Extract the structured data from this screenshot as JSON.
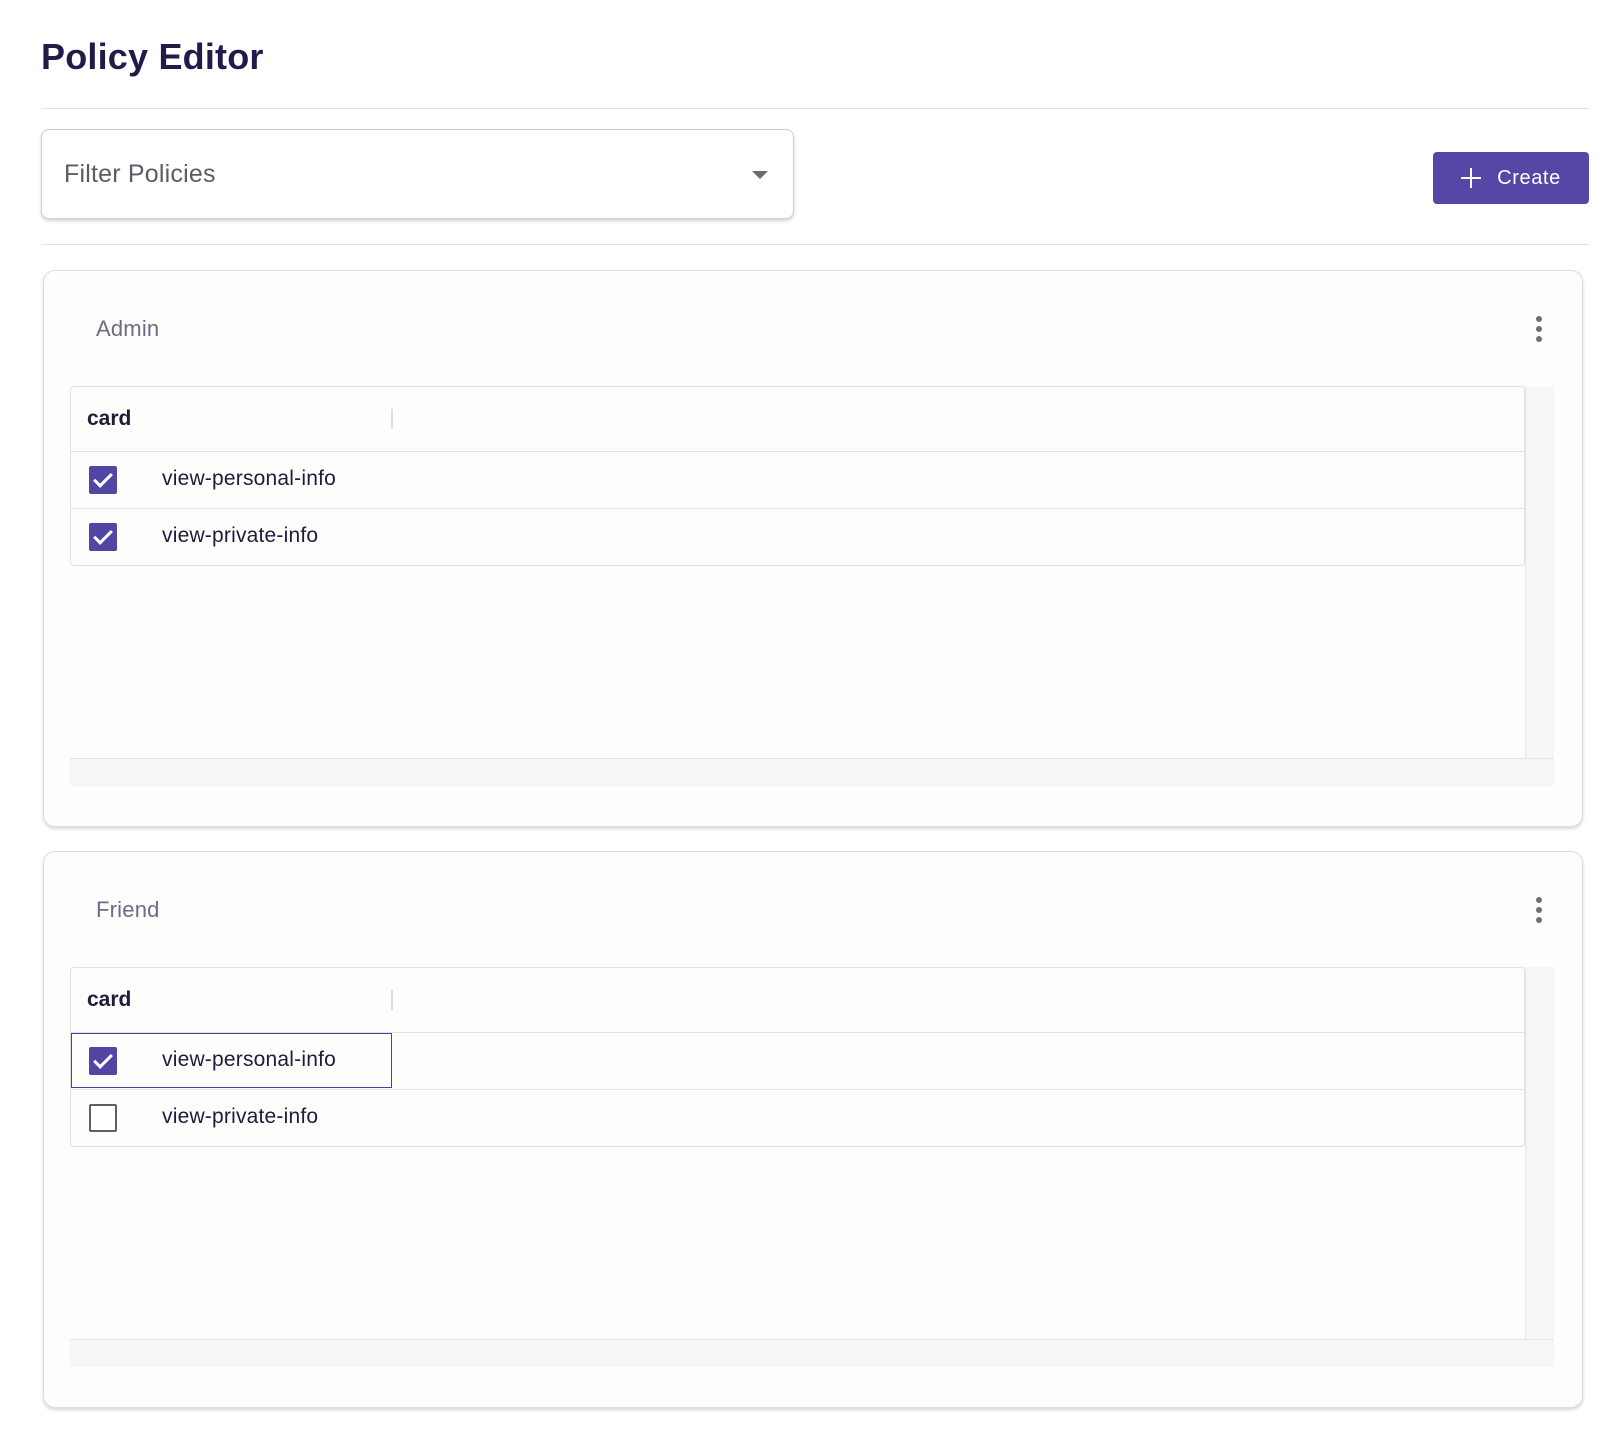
{
  "page": {
    "title": "Policy Editor"
  },
  "toolbar": {
    "filter_placeholder": "Filter Policies",
    "create_label": "Create"
  },
  "colors": {
    "accent": "#5447a6",
    "title": "#201c4a",
    "policy_name": "#6d6b85"
  },
  "policies": [
    {
      "name": "Admin",
      "table": {
        "column_header": "card",
        "rows": [
          {
            "label": "view-personal-info",
            "checked": true
          },
          {
            "label": "view-private-info",
            "checked": true
          }
        ]
      }
    },
    {
      "name": "Friend",
      "table": {
        "column_header": "card",
        "rows": [
          {
            "label": "view-personal-info",
            "checked": true,
            "focused": true
          },
          {
            "label": "view-private-info",
            "checked": false
          }
        ]
      }
    }
  ],
  "icons": {
    "create": "plus-icon",
    "filter": "caret-down-icon",
    "policy_menu": "more-vertical-icon"
  }
}
